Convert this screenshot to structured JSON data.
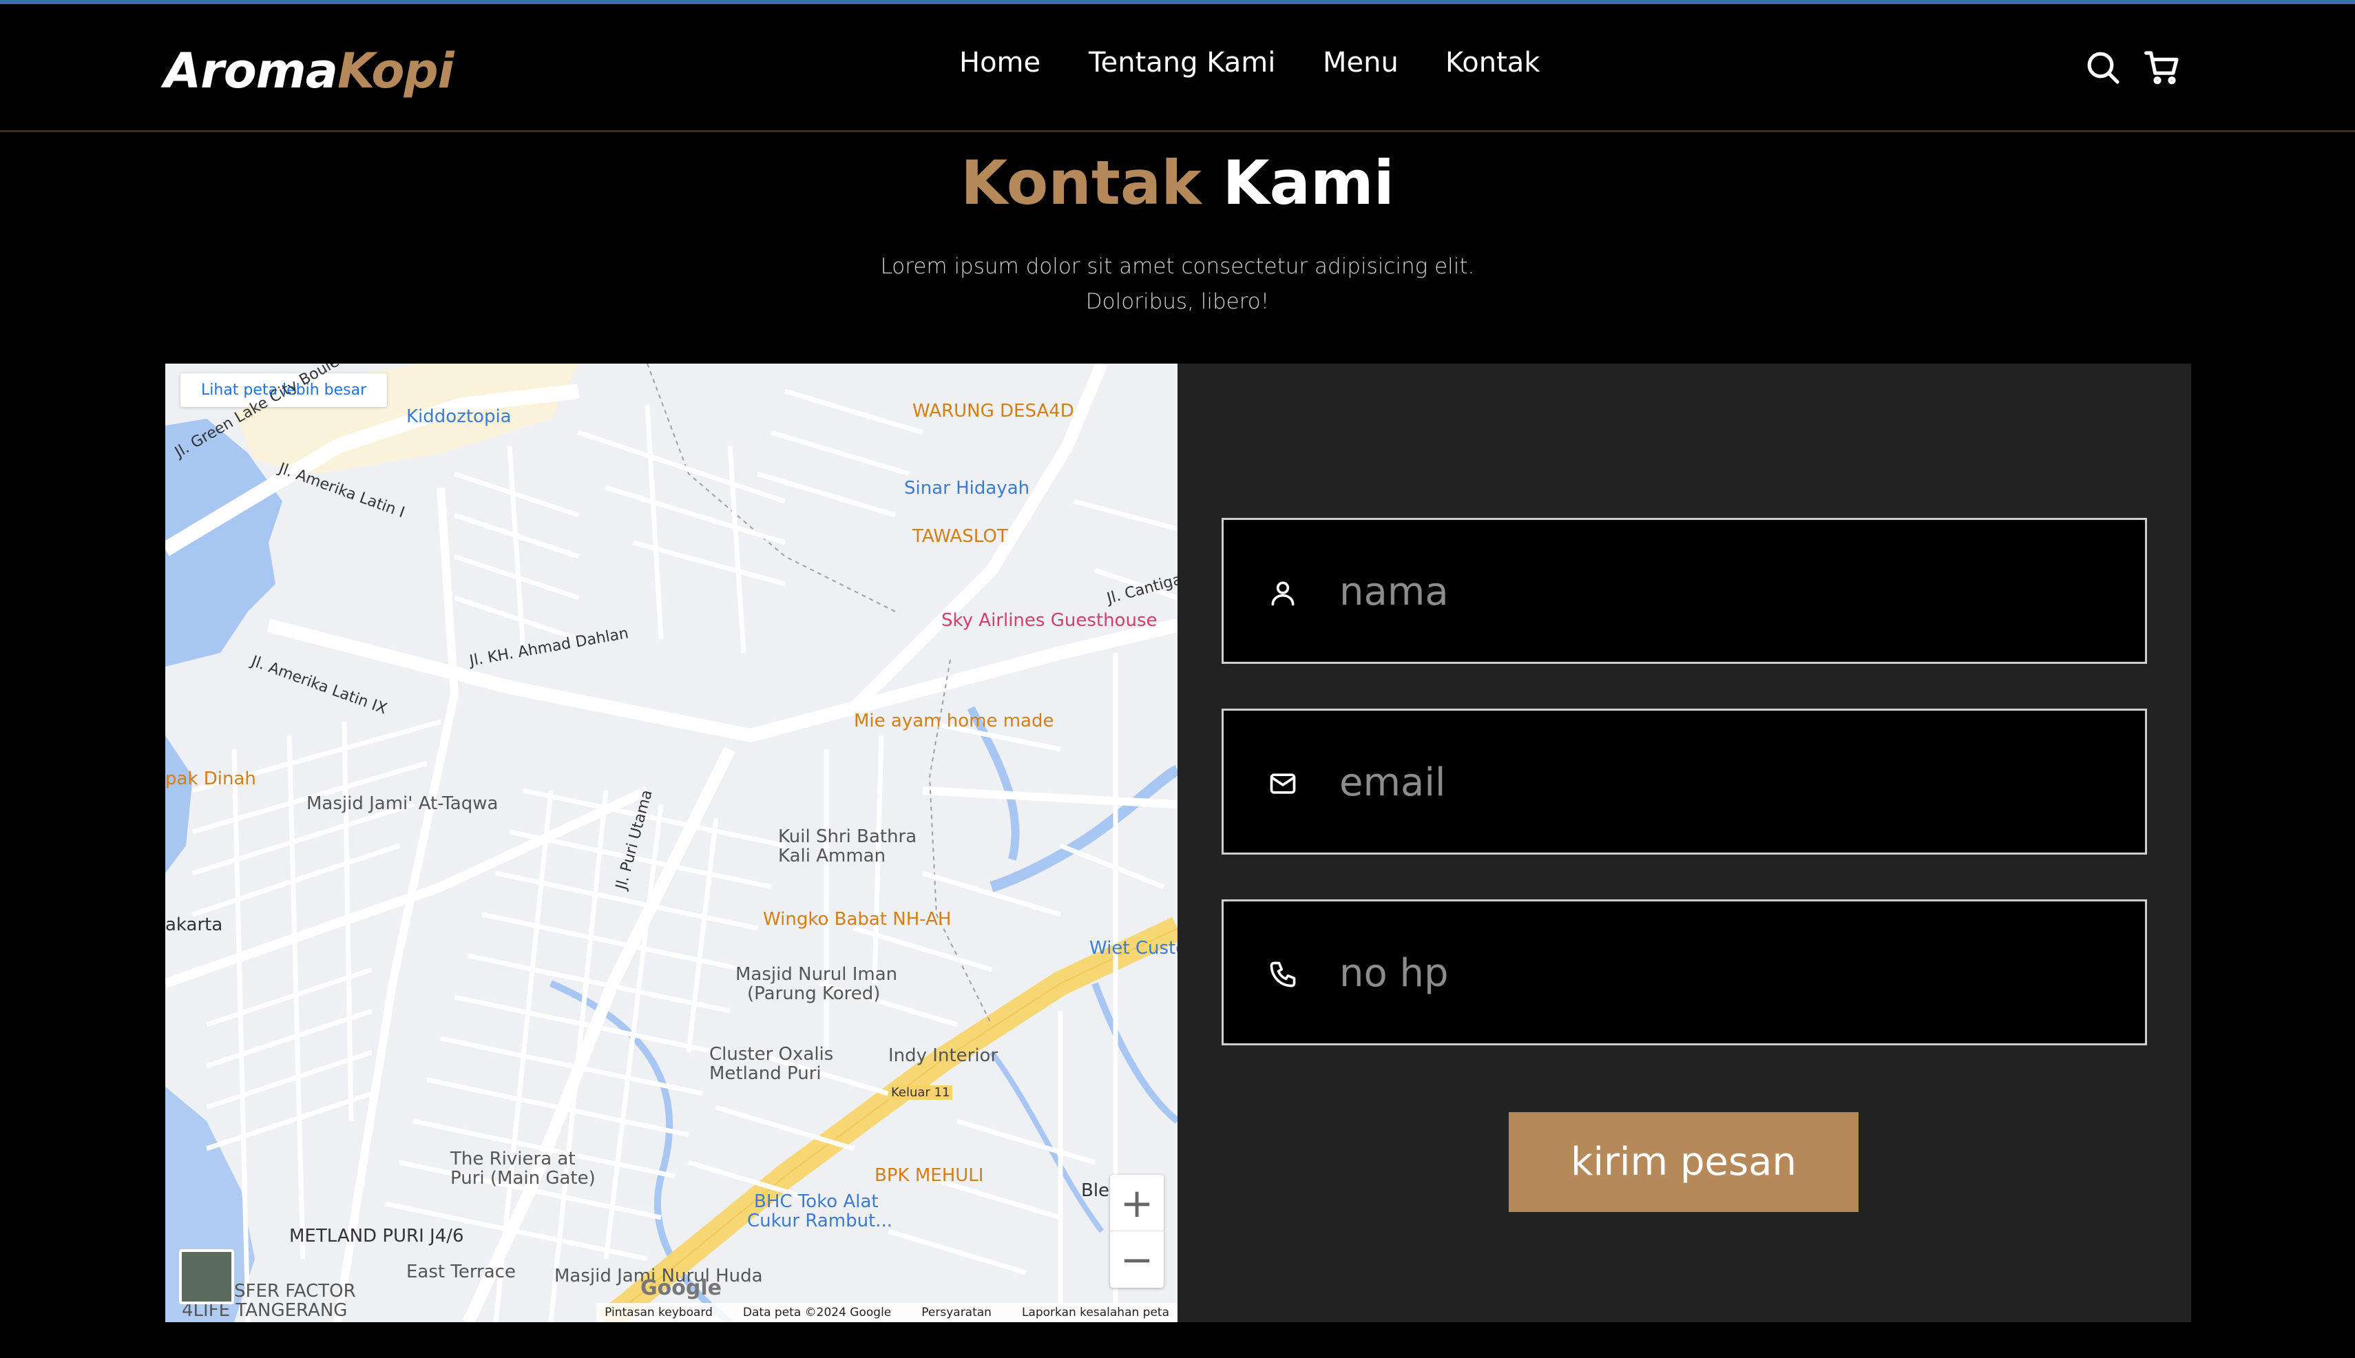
{
  "brand": {
    "part1": "Aroma",
    "part2": "Kopi"
  },
  "nav": {
    "home": "Home",
    "about": "Tentang Kami",
    "menu": "Menu",
    "contact": "Kontak"
  },
  "nav_icons": {
    "search": "search-icon",
    "cart": "cart-icon"
  },
  "section": {
    "title_part1": "Kontak",
    "title_part2": "Kami",
    "subtitle_line1": "Lorem ipsum dolor sit amet consectetur adipisicing elit.",
    "subtitle_line2": "Doloribus, libero!"
  },
  "map": {
    "link": "Lihat peta lebih besar",
    "labels": {
      "kiddoztopia": "Kiddoztopia",
      "warung": "WARUNG DESA4D",
      "sinar": "Sinar Hidayah",
      "tawaslot": "TAWASLOT",
      "sky": "Sky Airlines Guesthouse",
      "mieayam": "Mie ayam home made",
      "masjidjami": "Masjid Jami' At-Taqwa",
      "kuil1": "Kuil Shri Bathra",
      "kuil2": "Kali Amman",
      "wingko": "Wingko Babat NH-AH",
      "wiet": "Wiet Custo",
      "nurul1": "Masjid Nurul Iman",
      "nurul2": "(Parung Kored)",
      "cluster1": "Cluster Oxalis",
      "cluster2": "Metland Puri",
      "indy": "Indy Interior",
      "bpk": "BPK MEHULI",
      "bhc1": "BHC Toko Alat",
      "bhc2": "Cukur Rambut...",
      "riviera1": "The Riviera at",
      "riviera2": "Puri (Main Gate)",
      "metland": "METLAND PURI J4/6",
      "eastterrace": "East Terrace",
      "masjidjami2": "Masjid Jami Nurul Huda",
      "transfer": "SFER FACTOR",
      "life": "4LIFE TANGERANG",
      "pakdinah": "pak Dinah",
      "akarta": "akarta",
      "ble": "Ble",
      "keluar": "Keluar 11",
      "road_greenlake": "Jl. Green Lake City Boulevard",
      "road_amerika": "Jl. Amerika Latin I",
      "road_ahmad": "Jl. KH. Ahmad Dahlan",
      "road_amerika9": "Jl. Amerika Latin IX",
      "road_puri": "Jl. Puri Utama",
      "road_cantiga": "Jl. Cantiga"
    },
    "google": "Google",
    "footer": [
      "Pintasan keyboard",
      "Data peta ©2024 Google",
      "Persyaratan",
      "Laporkan kesalahan peta"
    ],
    "zoom_in": "+",
    "zoom_out": "−"
  },
  "form": {
    "name_placeholder": "nama",
    "email_placeholder": "email",
    "phone_placeholder": "no hp",
    "submit": "kirim pesan",
    "icons": [
      "user-icon",
      "mail-icon",
      "phone-icon"
    ]
  },
  "colors": {
    "accent": "#b6895b",
    "background": "#010101",
    "panel": "#222222",
    "topline": "#3e6fa6"
  }
}
